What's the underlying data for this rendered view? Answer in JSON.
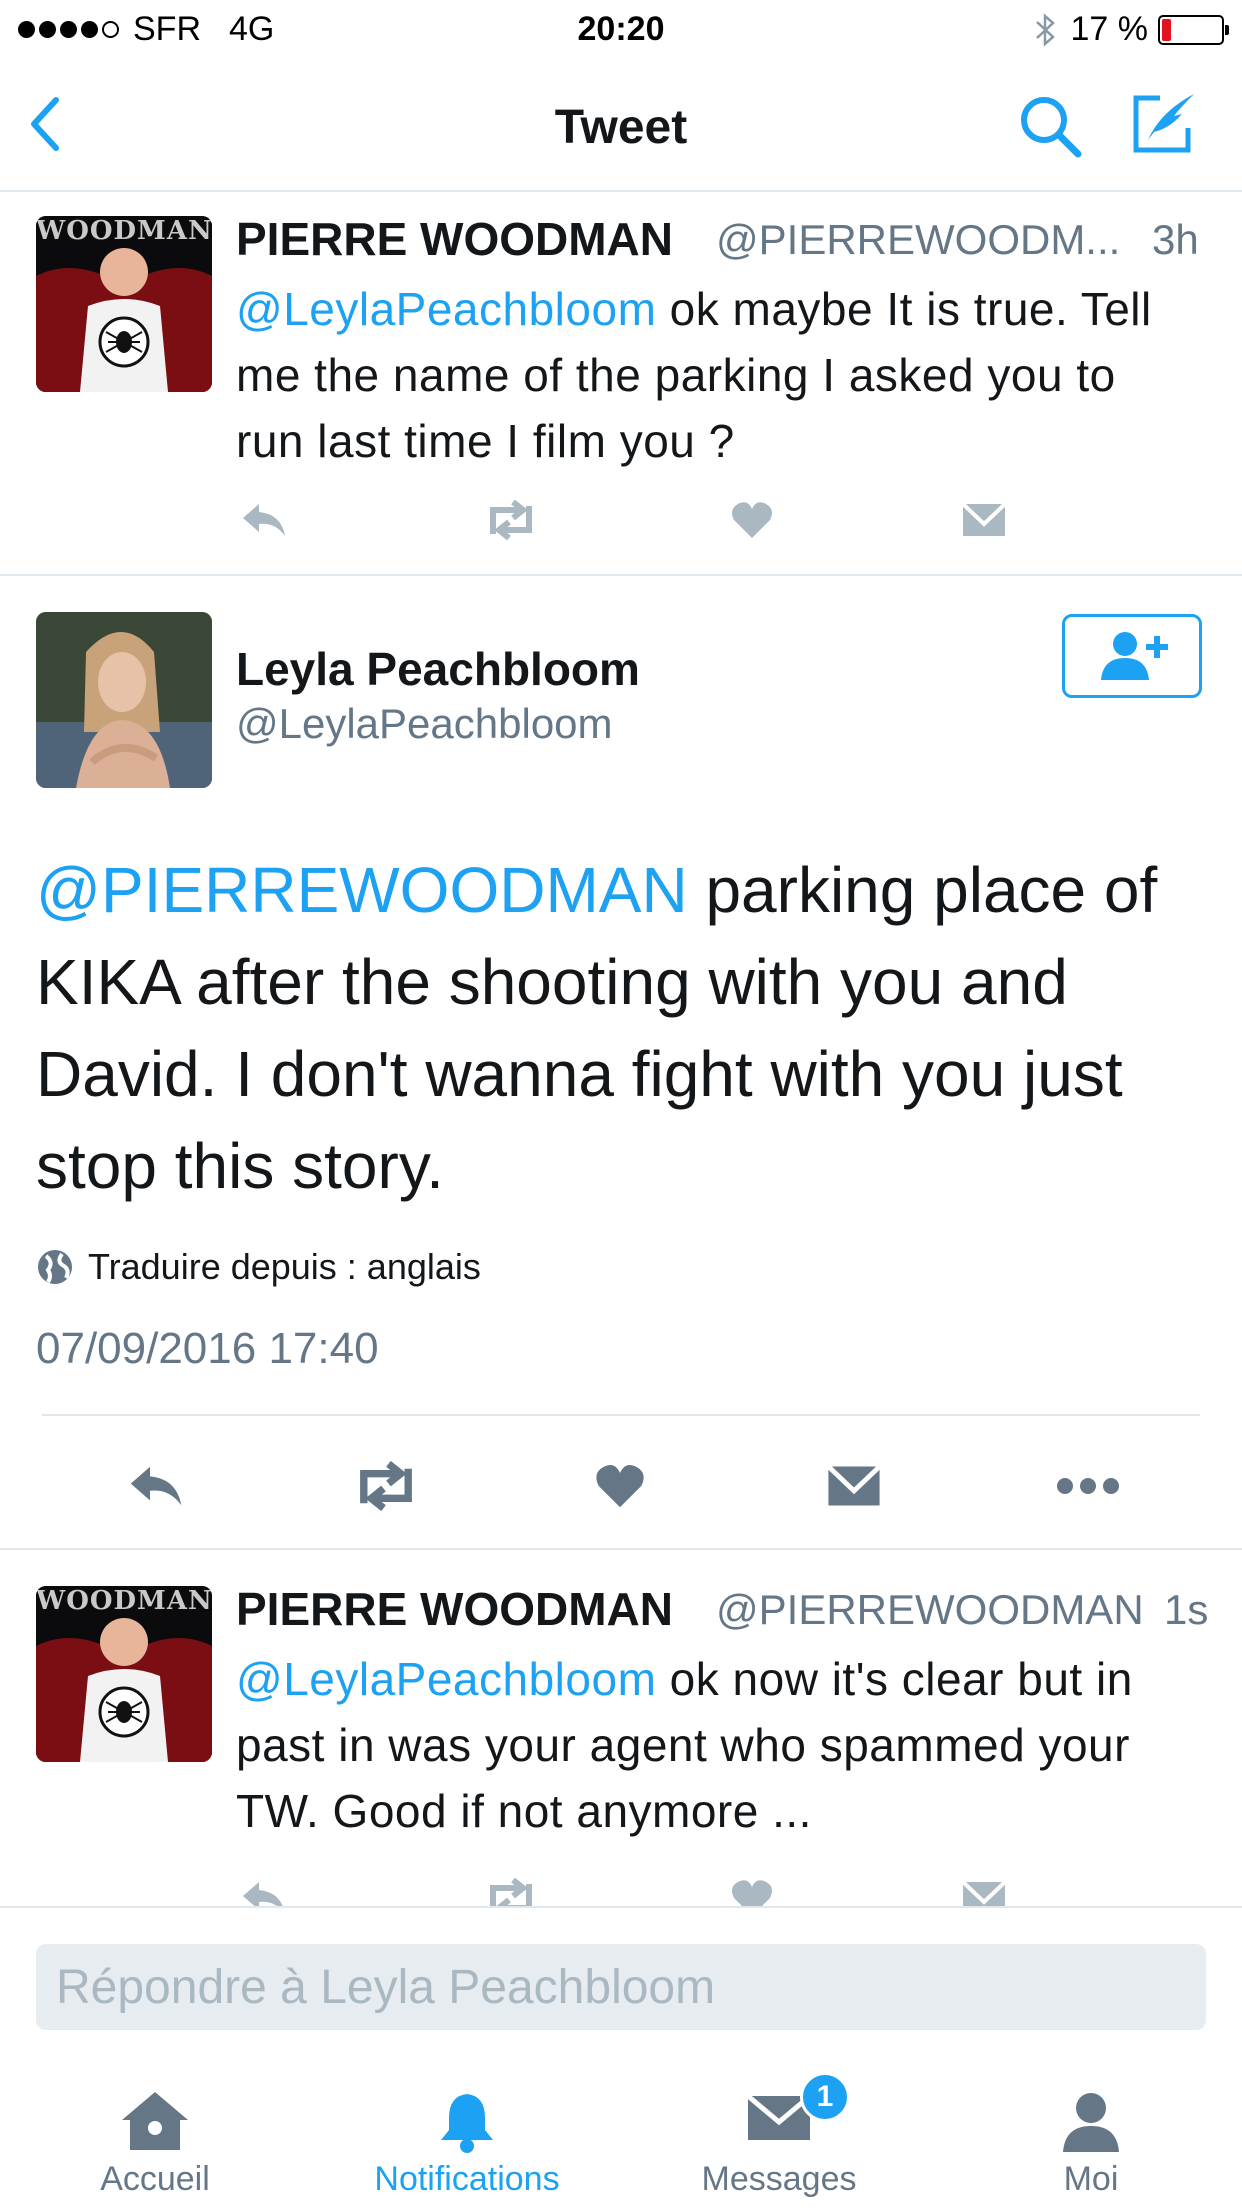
{
  "status_bar": {
    "carrier": "SFR",
    "network": "4G",
    "time": "20:20",
    "battery": "17 %",
    "battery_level": 0.17
  },
  "nav": {
    "title": "Tweet",
    "back_icon": "chevron-left-icon",
    "search_icon": "search-icon",
    "compose_icon": "compose-icon"
  },
  "tweet_prev": {
    "avatar_text": "WOODMAN",
    "name": "PIERRE WOODMAN",
    "handle": "@PIERREWOODM...",
    "time": "3h",
    "mention": "@LeylaPeachbloom",
    "text": " ok maybe It is true. Tell me the name of the parking I asked you to run last time I film you ?"
  },
  "tweet_main": {
    "name": "Leyla Peachbloom",
    "handle": "@LeylaPeachbloom",
    "mention": "@PIERREWOODMAN",
    "text": " parking place of KIKA after the shooting with you and David. I don't wanna fight with you just stop this story.",
    "translate": "Traduire depuis : anglais",
    "date": "07/09/2016 17:40"
  },
  "tweet_reply": {
    "avatar_text": "WOODMAN",
    "name": "PIERRE WOODMAN",
    "handle": "@PIERREWOODMAN",
    "time": "1s",
    "mention": "@LeylaPeachbloom",
    "text": " ok now it's clear but in past in was your agent who spammed your TW. Good if not anymore ..."
  },
  "reply_box": {
    "placeholder": "Répondre à Leyla Peachbloom"
  },
  "tabs": [
    {
      "label": "Accueil",
      "icon": "home-icon"
    },
    {
      "label": "Notifications",
      "icon": "bell-icon"
    },
    {
      "label": "Messages",
      "icon": "envelope-icon",
      "badge": "1"
    },
    {
      "label": "Moi",
      "icon": "person-icon"
    }
  ],
  "colors": {
    "accent": "#1da1f2",
    "text": "#14171a",
    "secondary": "#657786",
    "divider": "#e1e8ed",
    "icon_grey": "#aab8c2",
    "battery_low": "#e0141e"
  }
}
